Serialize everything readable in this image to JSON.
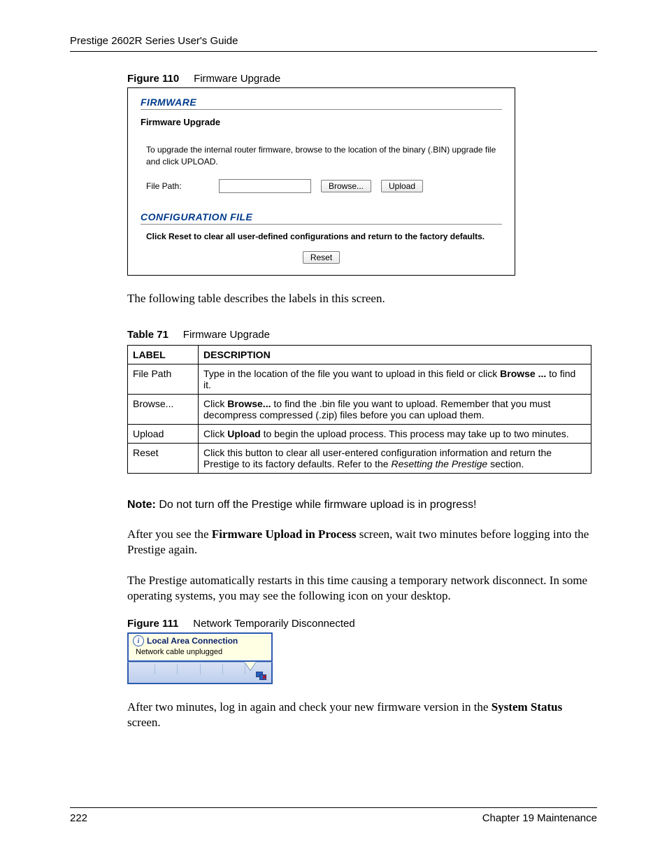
{
  "header": {
    "title": "Prestige 2602R Series User's Guide"
  },
  "figure110": {
    "label_num": "Figure 110",
    "label_text": "Firmware Upgrade",
    "head_firmware": "FIRMWARE",
    "sub_firmware": "Firmware Upgrade",
    "instr": "To upgrade the internal router firmware, browse to the location of the binary (.BIN) upgrade file and click UPLOAD.",
    "filepath_label": "File Path:",
    "browse_label": "Browse...",
    "upload_label": "Upload",
    "head_config": "CONFIGURATION FILE",
    "reset_instr": "Click Reset to clear all user-defined configurations and return to the factory defaults.",
    "reset_label": "Reset"
  },
  "para_intro": "The following table describes the labels in this screen.",
  "table71": {
    "label_num": "Table 71",
    "label_text": "Firmware Upgrade",
    "col_label": "LABEL",
    "col_desc": "DESCRIPTION",
    "rows": {
      "filepath": {
        "label": "File Path",
        "d1": "Type in the location of the file you want to upload in this field or click ",
        "d2": "Browse ...",
        "d3": " to find it."
      },
      "browse": {
        "label": "Browse...",
        "d1": "Click ",
        "d2": "Browse...",
        "d3": " to find the .bin file you want to upload. Remember that you must decompress compressed (.zip) files before you can upload them."
      },
      "upload": {
        "label": "Upload",
        "d1": "Click ",
        "d2": "Upload",
        "d3": " to begin the upload process. This process may take up to two minutes."
      },
      "reset": {
        "label": "Reset",
        "d1": "Click this button to clear all user-entered configuration information and return the Prestige to its factory defaults. Refer to the ",
        "d2": "Resetting the Prestige",
        "d3": " section."
      }
    }
  },
  "note": {
    "label": "Note:",
    "text": " Do not turn off the Prestige while firmware upload is in progress!"
  },
  "para_after1a": "After you see the ",
  "para_after1b": "Firmware Upload in Process",
  "para_after1c": " screen, wait two minutes before logging into the Prestige again.",
  "para_after2": "The Prestige automatically restarts in this time causing a temporary network disconnect. In some operating systems, you may see the following icon on your desktop.",
  "figure111": {
    "label_num": "Figure 111",
    "label_text": "Network Temporarily Disconnected",
    "lac_title": "Local Area Connection",
    "lac_sub": "Network cable unplugged"
  },
  "para_after3a": "After two minutes, log in again and check your new firmware version in the ",
  "para_after3b": "System Status",
  "para_after3c": " screen.",
  "footer": {
    "page": "222",
    "chapter": "Chapter 19 Maintenance"
  }
}
